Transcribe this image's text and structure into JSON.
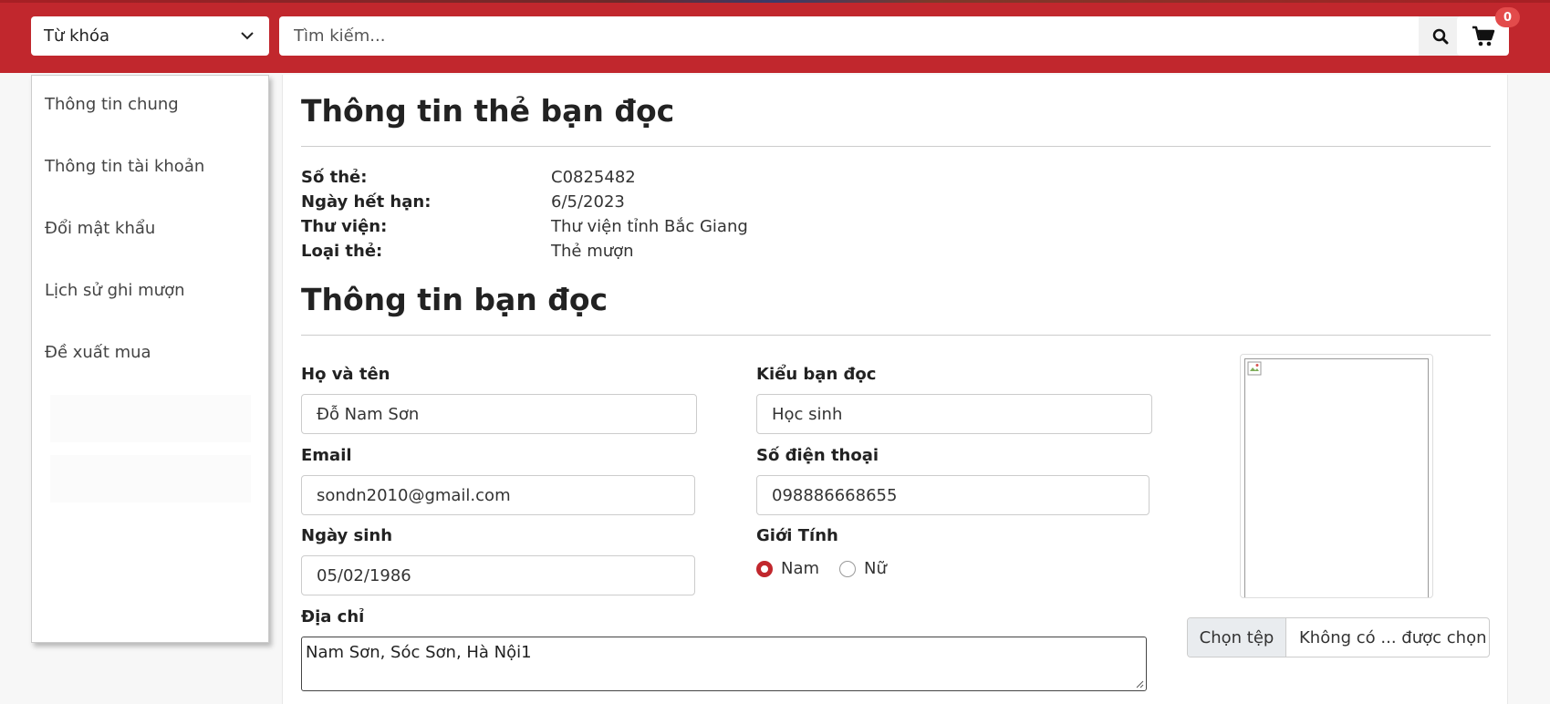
{
  "header": {
    "keyword_select": "Từ khóa",
    "search_placeholder": "Tìm kiếm...",
    "cart_count": "0"
  },
  "sidebar": {
    "items": [
      {
        "label": "Thông tin chung"
      },
      {
        "label": "Thông tin tài khoản"
      },
      {
        "label": "Đổi mật khẩu"
      },
      {
        "label": "Lịch sử ghi mượn"
      },
      {
        "label": "Đề xuất mua"
      }
    ]
  },
  "card": {
    "title": "Thông tin thẻ bạn đọc",
    "rows": [
      {
        "label": "Số thẻ:",
        "value": "C0825482"
      },
      {
        "label": "Ngày hết hạn:",
        "value": "6/5/2023"
      },
      {
        "label": "Thư viện:",
        "value": "Thư viện tỉnh Bắc Giang"
      },
      {
        "label": "Loại thẻ:",
        "value": "Thẻ mượn"
      }
    ]
  },
  "reader": {
    "title": "Thông tin bạn đọc",
    "fullname_label": "Họ và tên",
    "fullname_value": "Đỗ Nam Sơn",
    "type_label": "Kiểu bạn đọc",
    "type_value": "Học sinh",
    "email_label": "Email",
    "email_value": "sondn2010@gmail.com",
    "phone_label": "Số điện thoại",
    "phone_value": "098886668655",
    "dob_label": "Ngày sinh",
    "dob_value": "05/02/1986",
    "gender_label": "Giới Tính",
    "gender_male": "Nam",
    "gender_female": "Nữ",
    "gender_selected": "Nam",
    "address_label": "Địa chỉ",
    "address_value": "Nam Sơn, Sóc Sơn, Hà Nội1",
    "file_button": "Chọn tệp",
    "file_name": "Không có ... được chọn"
  },
  "colors": {
    "brand": "#c1272d",
    "badge": "#e34b4b"
  }
}
